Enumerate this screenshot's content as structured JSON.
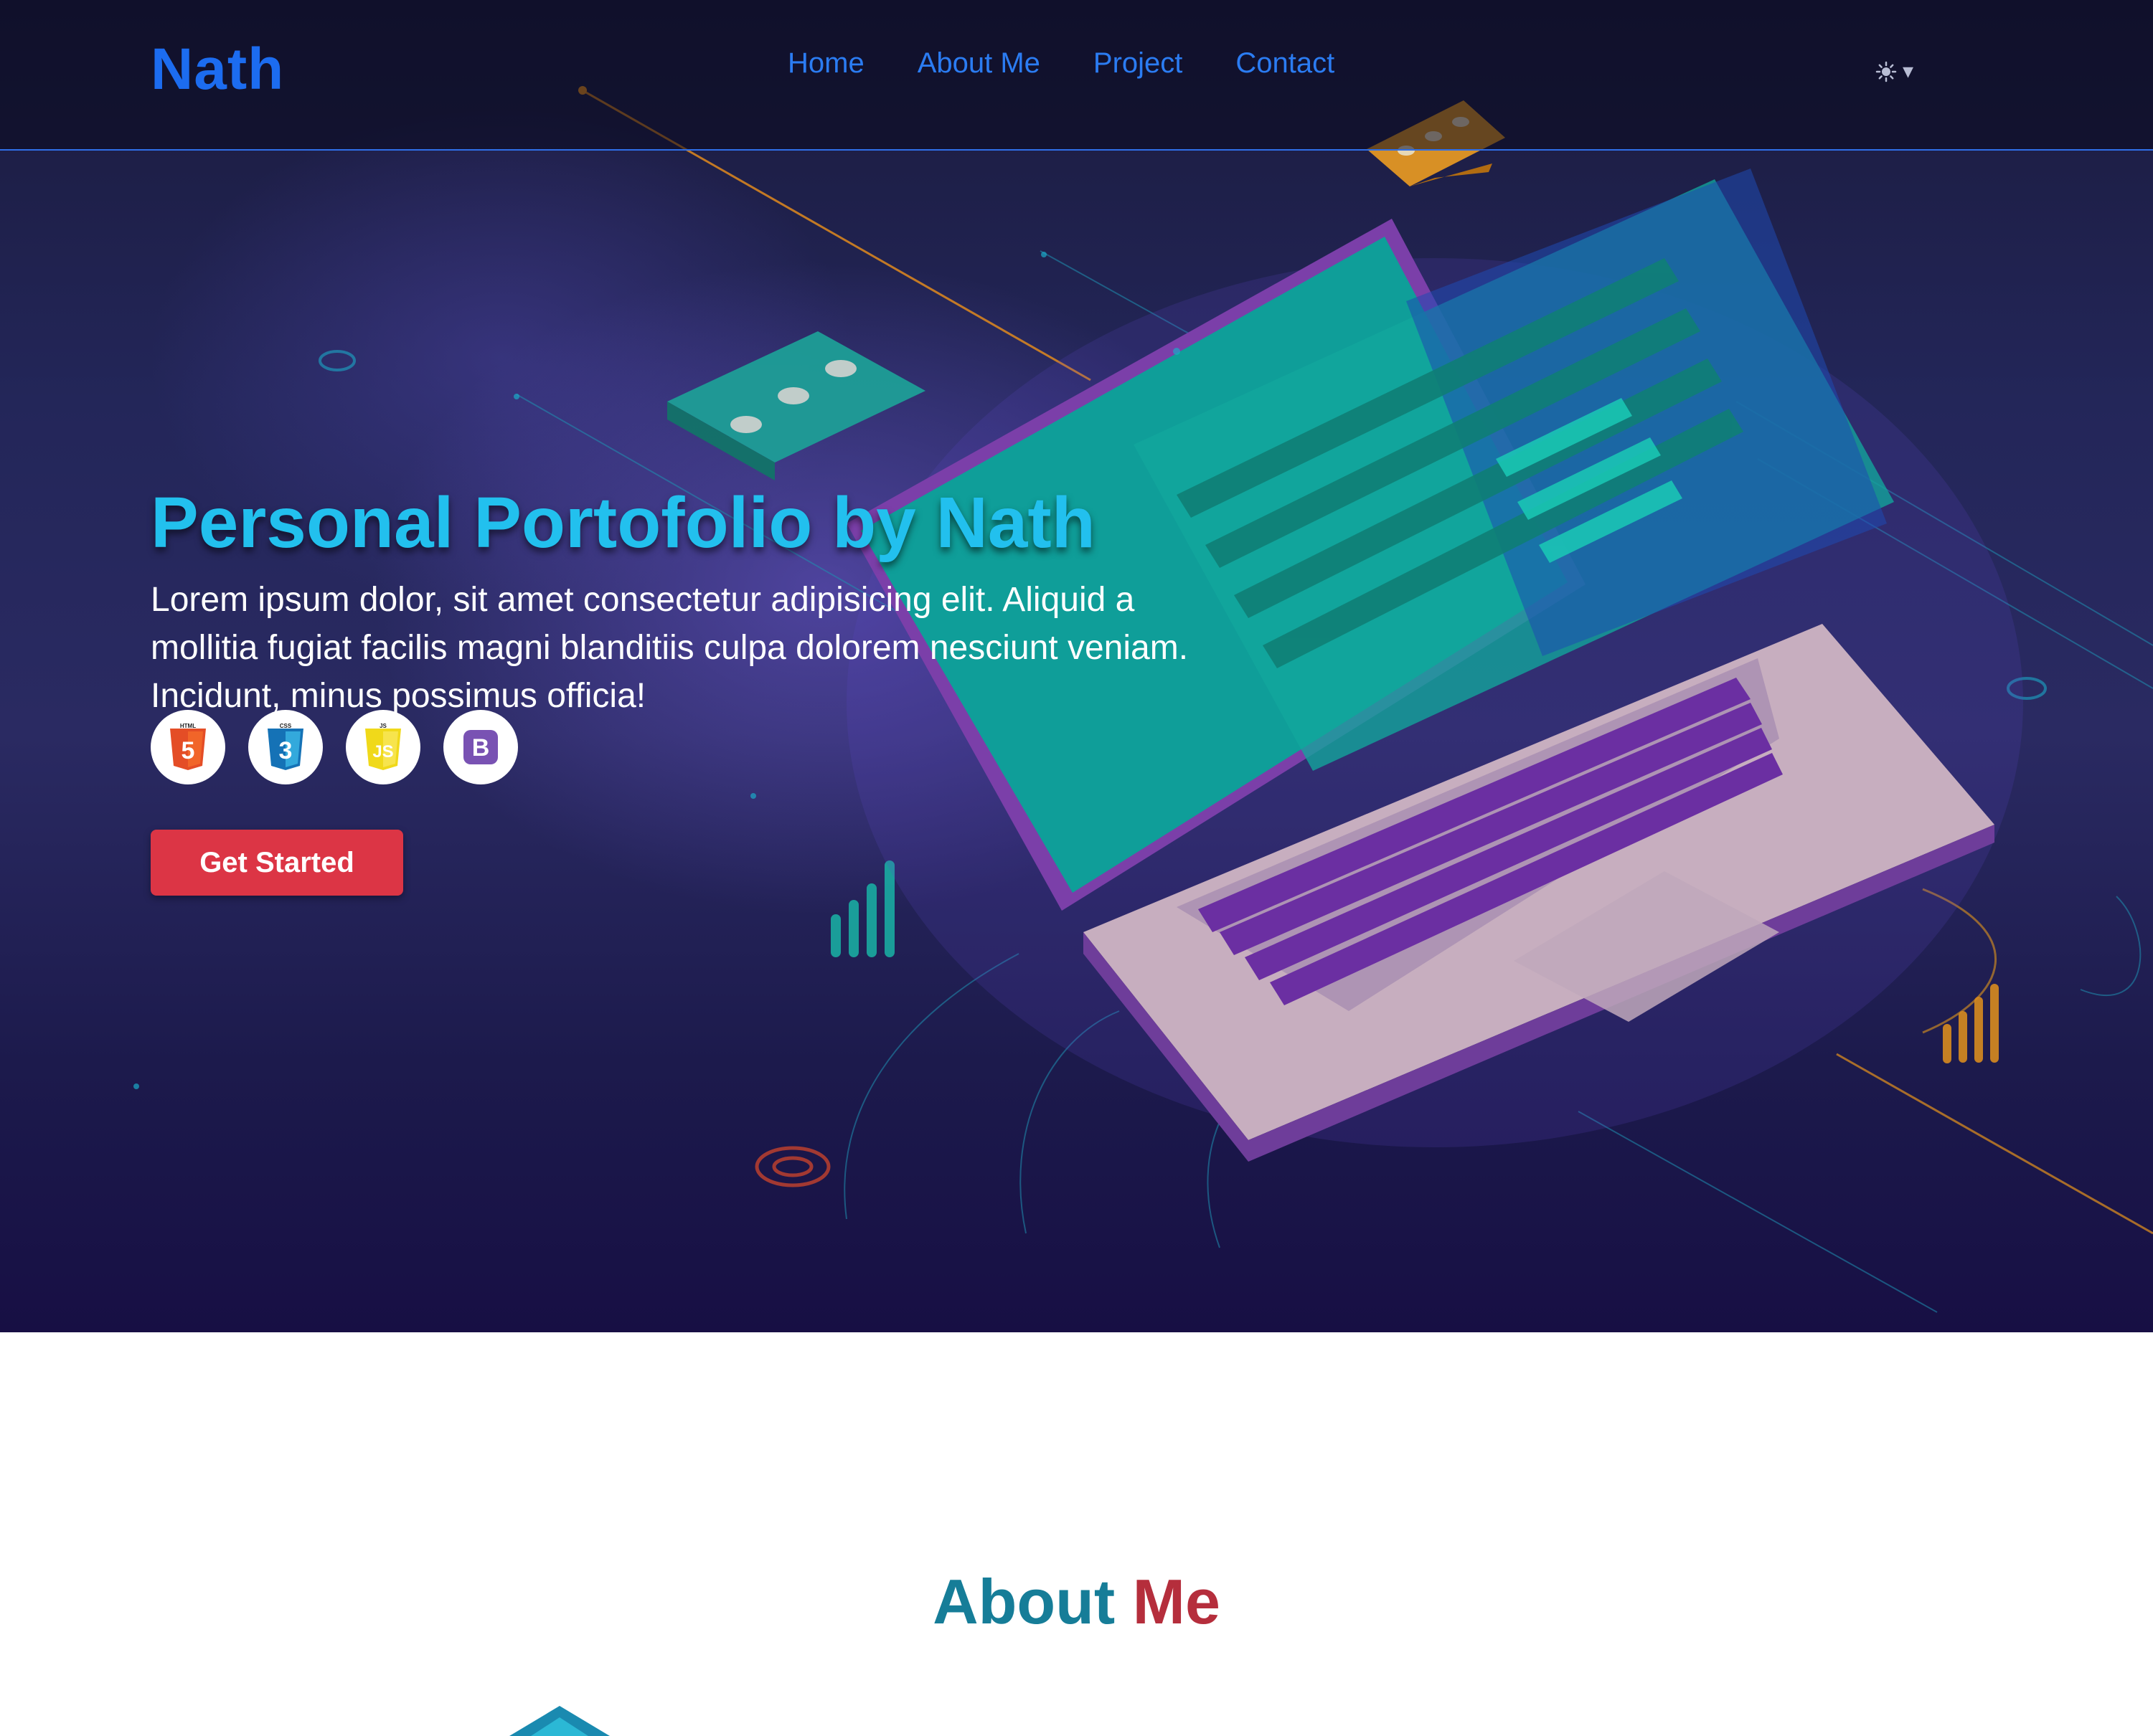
{
  "brand": "Nath",
  "nav": {
    "items": [
      {
        "label": "Home"
      },
      {
        "label": "About Me"
      },
      {
        "label": "Project"
      },
      {
        "label": "Contact"
      }
    ],
    "theme_toggle": {
      "icon": "sun-icon",
      "caret": "▾"
    }
  },
  "hero": {
    "title": "Personal Portofolio by Nath",
    "description": "Lorem ipsum dolor, sit amet consectetur adipisicing elit. Aliquid a mollitia fugiat facilis magni blanditiis culpa dolorem nesciunt veniam. Incidunt, minus possimus officia!",
    "tech_icons": [
      {
        "icon": "html5-icon",
        "label": "HTML",
        "glyph": "5",
        "color": "#e44d26"
      },
      {
        "icon": "css3-icon",
        "label": "CSS",
        "glyph": "3",
        "color": "#1572b6"
      },
      {
        "icon": "javascript-icon",
        "label": "JS",
        "glyph": "JS",
        "color": "#f0d91a"
      },
      {
        "icon": "bootstrap-icon",
        "label": "",
        "glyph": "B",
        "color": "#7952b3"
      }
    ],
    "cta_label": "Get Started"
  },
  "about": {
    "title_part1": "About",
    "title_part2": "Me"
  },
  "colors": {
    "brand_blue": "#1c6cf0",
    "title_cyan": "#22c0ee",
    "cta_red": "#dc3545",
    "about_teal": "#167d98",
    "about_red": "#b52e3c"
  }
}
